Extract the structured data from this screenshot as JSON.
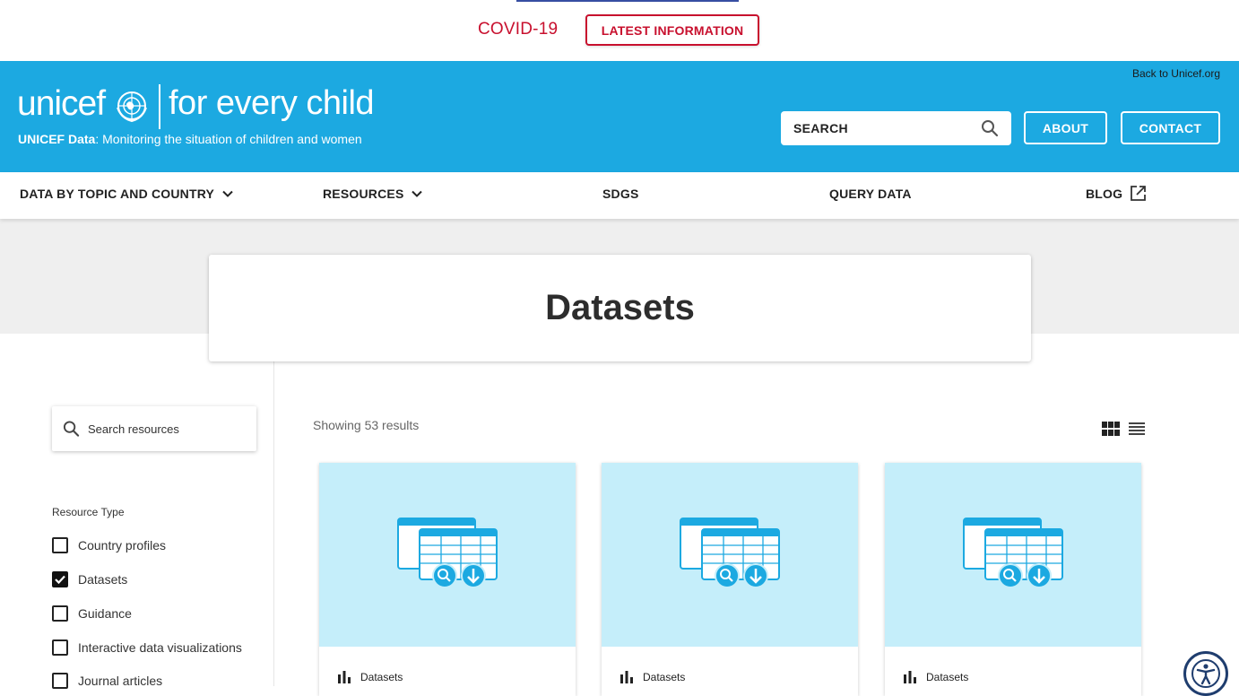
{
  "covid": {
    "label": "COVID-19",
    "button": "LATEST INFORMATION"
  },
  "header": {
    "logo_word": "unicef",
    "tagline": "for every child",
    "subtitle_bold": "UNICEF Data",
    "subtitle_rest": ": Monitoring the situation of children and women",
    "back_link": "Back to Unicef.org",
    "search_placeholder": "SEARCH",
    "about": "ABOUT",
    "contact": "CONTACT"
  },
  "nav": {
    "items": [
      {
        "label": "DATA BY TOPIC AND COUNTRY"
      },
      {
        "label": "RESOURCES"
      },
      {
        "label": "SDGS"
      },
      {
        "label": "QUERY DATA"
      },
      {
        "label": "BLOG"
      }
    ]
  },
  "page": {
    "title": "Datasets"
  },
  "sidebar": {
    "search_placeholder": "Search resources",
    "resource_type_title": "Resource Type",
    "filters": [
      {
        "label": "Country profiles",
        "checked": false
      },
      {
        "label": "Datasets",
        "checked": true
      },
      {
        "label": "Guidance",
        "checked": false
      },
      {
        "label": "Interactive data visualizations",
        "checked": false
      },
      {
        "label": "Journal articles",
        "checked": false
      }
    ]
  },
  "results": {
    "count_text": "Showing 53 results",
    "cards": [
      {
        "type": "Datasets"
      },
      {
        "type": "Datasets"
      },
      {
        "type": "Datasets"
      }
    ]
  },
  "colors": {
    "brand_blue": "#1ca9e1",
    "covid_red": "#c8102e",
    "card_bg": "#c5eefa"
  }
}
